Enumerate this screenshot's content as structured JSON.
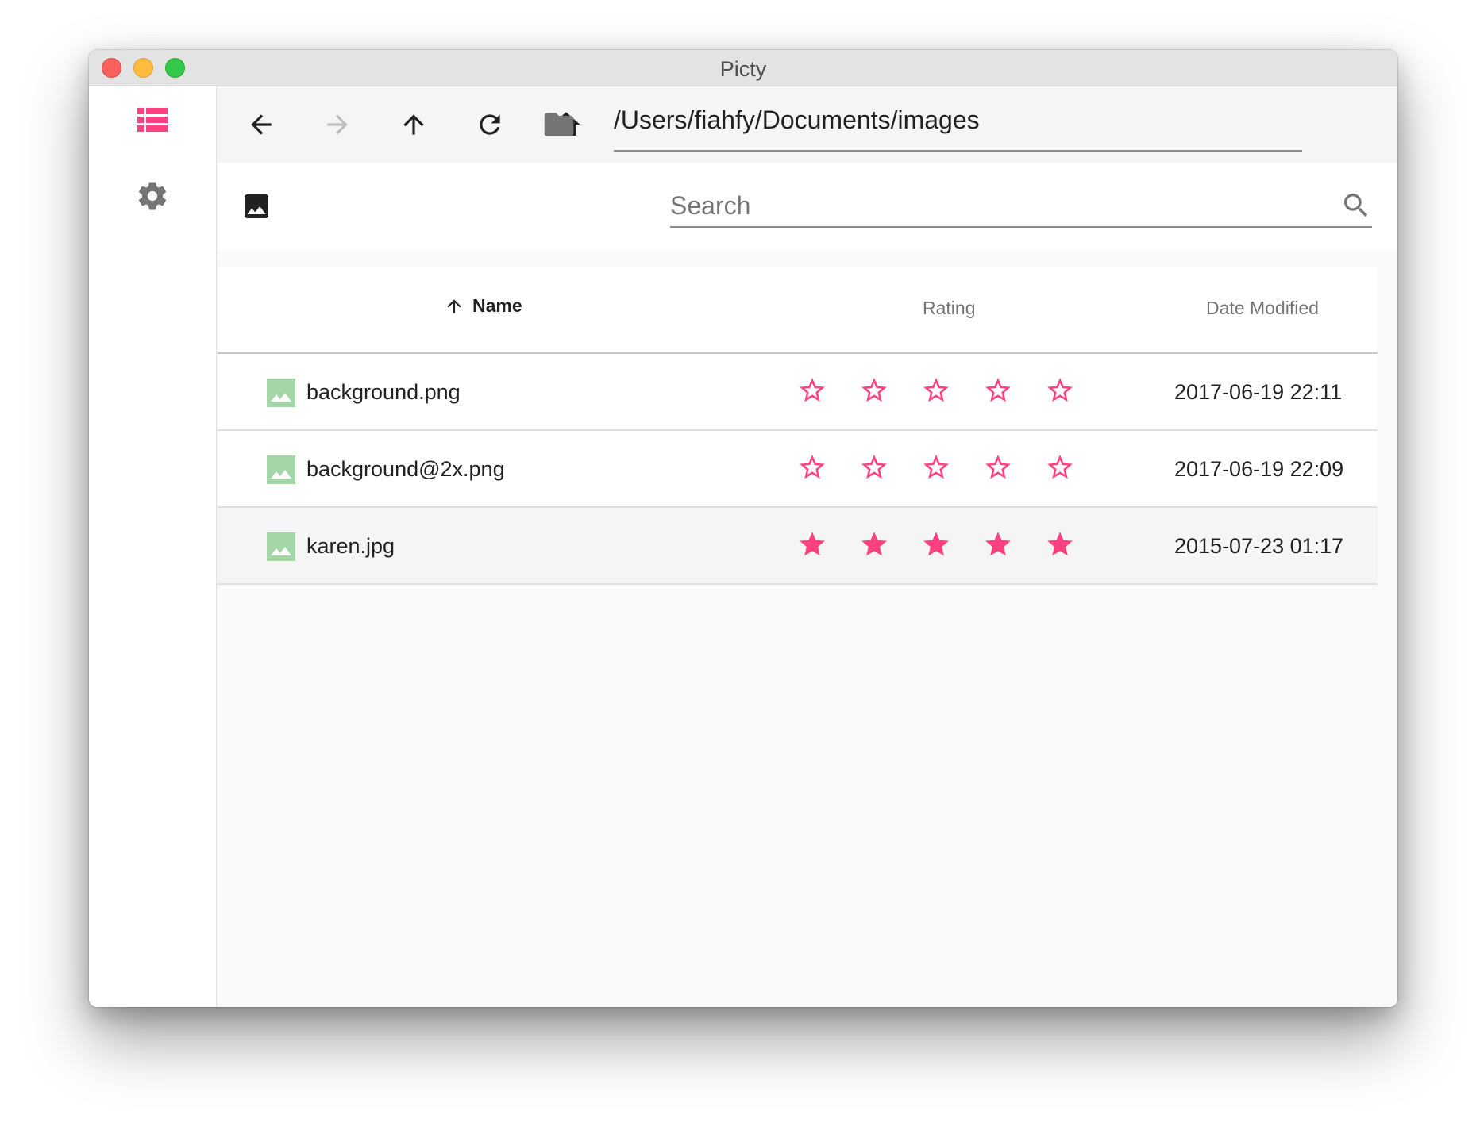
{
  "window": {
    "title": "Picty"
  },
  "sidebar": {
    "items": [
      {
        "icon": "view-list-icon",
        "active": true
      },
      {
        "icon": "gear-icon",
        "active": false
      }
    ]
  },
  "toolbar": {
    "buttons": [
      {
        "icon": "arrow-back-icon",
        "enabled": true
      },
      {
        "icon": "arrow-forward-icon",
        "enabled": false
      },
      {
        "icon": "arrow-up-icon",
        "enabled": true
      },
      {
        "icon": "refresh-icon",
        "enabled": true
      },
      {
        "icon": "home-icon",
        "enabled": true
      }
    ],
    "path": "/Users/fiahfy/Documents/images"
  },
  "search": {
    "placeholder": "Search",
    "value": ""
  },
  "table": {
    "columns": {
      "name": "Name",
      "rating": "Rating",
      "date": "Date Modified"
    },
    "sort": {
      "column": "name",
      "direction": "ascending"
    },
    "max_rating": 5,
    "rows": [
      {
        "name": "background.png",
        "rating": 0,
        "date": "2017-06-19 22:11",
        "selected": false
      },
      {
        "name": "background@2x.png",
        "rating": 0,
        "date": "2017-06-19 22:09",
        "selected": false
      },
      {
        "name": "karen.jpg",
        "rating": 5,
        "date": "2015-07-23 01:17",
        "selected": true
      }
    ]
  },
  "colors": {
    "accent": "#ff4081",
    "icon": "#757575",
    "file_icon": "#a5d6a7",
    "disabled": "#bdbdbd"
  }
}
